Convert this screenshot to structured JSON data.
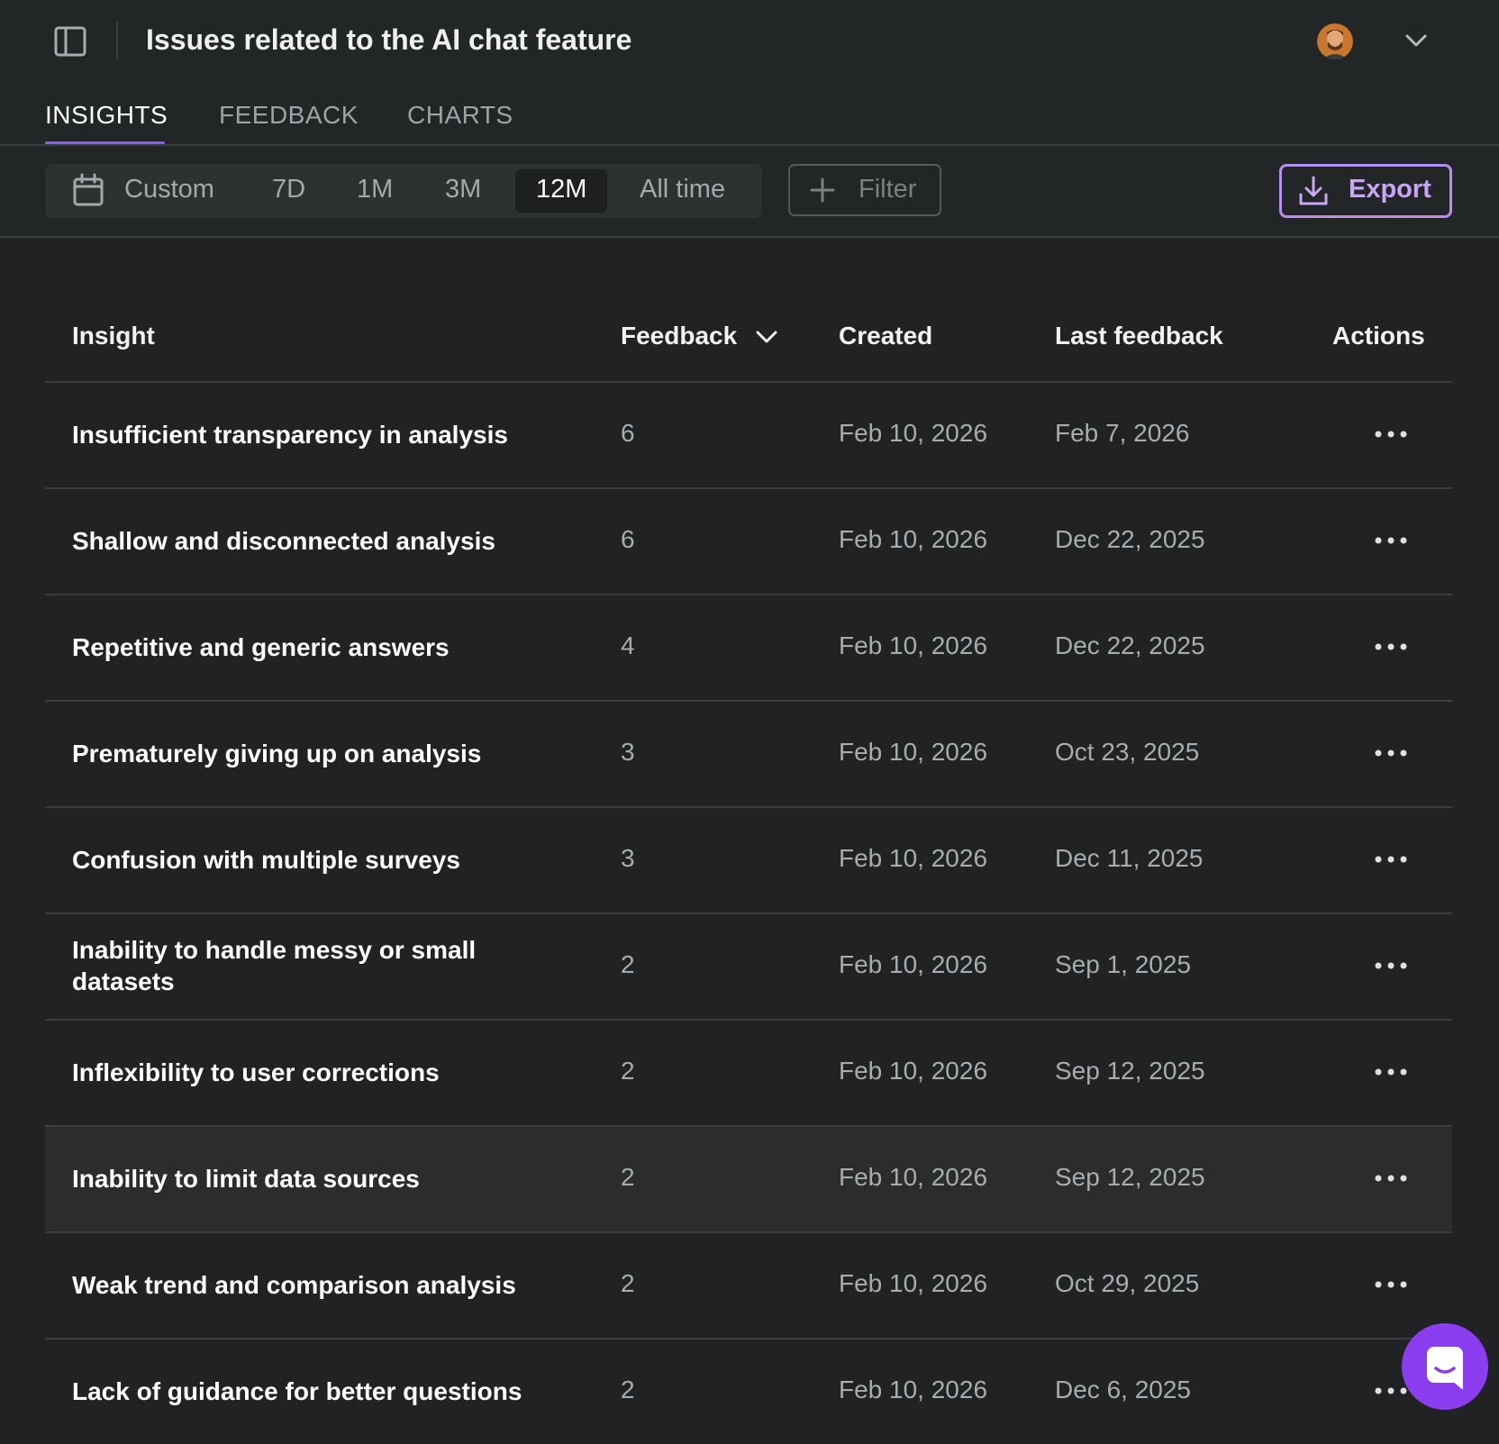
{
  "header": {
    "title": "Issues related to the AI chat feature"
  },
  "tabs": [
    {
      "label": "INSIGHTS",
      "active": true
    },
    {
      "label": "FEEDBACK",
      "active": false
    },
    {
      "label": "CHARTS",
      "active": false
    }
  ],
  "date_range": {
    "options": [
      "Custom",
      "7D",
      "1M",
      "3M",
      "12M",
      "All time"
    ],
    "selected": "12M"
  },
  "filter": {
    "label": "Filter"
  },
  "export": {
    "label": "Export"
  },
  "colors": {
    "accent": "#8b5cf6",
    "export_border": "#b98cf2",
    "chat_button": "#8b3df0",
    "background": "#202223"
  },
  "table": {
    "columns": {
      "insight": "Insight",
      "feedback": "Feedback",
      "created": "Created",
      "last_feedback": "Last feedback",
      "actions": "Actions"
    },
    "sorted_by": "Feedback",
    "rows": [
      {
        "insight": "Insufficient transparency in analysis",
        "feedback": "6",
        "created": "Feb 10, 2026",
        "last_feedback": "Feb 7, 2026"
      },
      {
        "insight": "Shallow and disconnected analysis",
        "feedback": "6",
        "created": "Feb 10, 2026",
        "last_feedback": "Dec 22, 2025"
      },
      {
        "insight": "Repetitive and generic answers",
        "feedback": "4",
        "created": "Feb 10, 2026",
        "last_feedback": "Dec 22, 2025"
      },
      {
        "insight": "Prematurely giving up on analysis",
        "feedback": "3",
        "created": "Feb 10, 2026",
        "last_feedback": "Oct 23, 2025"
      },
      {
        "insight": "Confusion with multiple surveys",
        "feedback": "3",
        "created": "Feb 10, 2026",
        "last_feedback": "Dec 11, 2025"
      },
      {
        "insight": "Inability to handle messy or small datasets",
        "feedback": "2",
        "created": "Feb 10, 2026",
        "last_feedback": "Sep 1, 2025"
      },
      {
        "insight": "Inflexibility to user corrections",
        "feedback": "2",
        "created": "Feb 10, 2026",
        "last_feedback": "Sep 12, 2025"
      },
      {
        "insight": "Inability to limit data sources",
        "feedback": "2",
        "created": "Feb 10, 2026",
        "last_feedback": "Sep 12, 2025"
      },
      {
        "insight": "Weak trend and comparison analysis",
        "feedback": "2",
        "created": "Feb 10, 2026",
        "last_feedback": "Oct 29, 2025"
      },
      {
        "insight": "Lack of guidance for better questions",
        "feedback": "2",
        "created": "Feb 10, 2026",
        "last_feedback": "Dec 6, 2025"
      }
    ]
  }
}
